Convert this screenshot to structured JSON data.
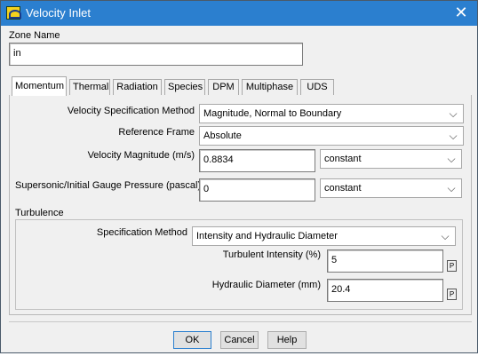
{
  "window": {
    "title": "Velocity Inlet"
  },
  "zone": {
    "label": "Zone Name",
    "value": "in"
  },
  "tabs": [
    {
      "label": "Momentum"
    },
    {
      "label": "Thermal"
    },
    {
      "label": "Radiation"
    },
    {
      "label": "Species"
    },
    {
      "label": "DPM"
    },
    {
      "label": "Multiphase"
    },
    {
      "label": "UDS"
    }
  ],
  "momentum": {
    "velocity_spec_method": {
      "label": "Velocity Specification Method",
      "value": "Magnitude, Normal to Boundary"
    },
    "reference_frame": {
      "label": "Reference Frame",
      "value": "Absolute"
    },
    "velocity_magnitude": {
      "label": "Velocity Magnitude (m/s)",
      "value": "0.8834",
      "profile": "constant"
    },
    "gauge_pressure": {
      "label": "Supersonic/Initial Gauge Pressure (pascal)",
      "value": "0",
      "profile": "constant"
    }
  },
  "turbulence": {
    "group_label": "Turbulence",
    "spec_method": {
      "label": "Specification Method",
      "value": "Intensity and Hydraulic Diameter"
    },
    "intensity": {
      "label": "Turbulent Intensity (%)",
      "value": "5",
      "param_button": "P"
    },
    "hydraulic_diameter": {
      "label": "Hydraulic Diameter (mm)",
      "value": "20.4",
      "param_button": "P"
    }
  },
  "buttons": {
    "ok": "OK",
    "cancel": "Cancel",
    "help": "Help"
  },
  "icons": {
    "app": "fluent-app-icon",
    "close": "close-icon",
    "dropdown": "chevron-down-icon"
  },
  "colors": {
    "titlebar": "#2b7fcf",
    "dialog_bg": "#f0f0f0"
  }
}
